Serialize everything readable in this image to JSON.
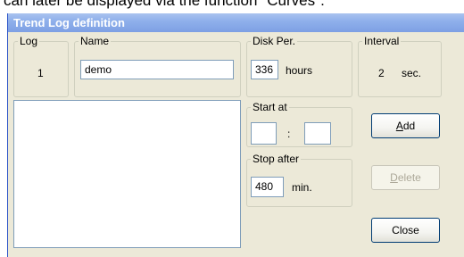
{
  "caption": "can later be displayed via the function \"Curves\".",
  "window": {
    "title": "Trend Log definition"
  },
  "log": {
    "legend": "Log",
    "value": "1"
  },
  "name": {
    "legend": "Name",
    "value": "demo"
  },
  "disk_per": {
    "legend": "Disk Per.",
    "value": "336",
    "unit": "hours"
  },
  "interval": {
    "legend": "Interval",
    "value": "2",
    "unit": "sec."
  },
  "start_at": {
    "legend": "Start at",
    "hours": "",
    "separator": ":",
    "minutes": ""
  },
  "stop_after": {
    "legend": "Stop after",
    "value": "480",
    "unit": "min."
  },
  "buttons": {
    "add": {
      "mnemonic": "A",
      "rest": "dd"
    },
    "delete": {
      "mnemonic": "D",
      "rest": "elete"
    },
    "close": {
      "label": "Close"
    }
  }
}
